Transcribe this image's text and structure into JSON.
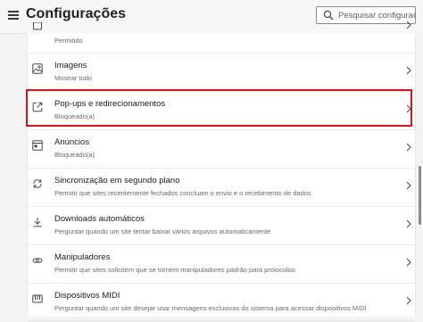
{
  "header": {
    "title": "Configurações",
    "search_placeholder": "Pesquisar configurações"
  },
  "rows": [
    {
      "label": "",
      "sub": "Permitido",
      "icon": "partial-icon"
    },
    {
      "label": "Imagens",
      "sub": "Mostrar tudo",
      "icon": "image-icon"
    },
    {
      "label": "Pop-ups e redirecionamentos",
      "sub": "Bloqueado(a)",
      "icon": "popup-icon",
      "highlighted": true
    },
    {
      "label": "Anúncios",
      "sub": "Bloqueado(a)",
      "icon": "ads-icon"
    },
    {
      "label": "Sincronização em segundo plano",
      "sub": "Permitir que sites recentemente fechados concluam o envio e o recebimento de dados",
      "icon": "sync-icon"
    },
    {
      "label": "Downloads automáticos",
      "sub": "Perguntar quando um site tentar baixar vários arquivos automaticamente",
      "icon": "download-icon"
    },
    {
      "label": "Manipuladores",
      "sub": "Permitir que sites solicitem que se tornem manipuladores padrão para protocolos",
      "icon": "link-icon"
    },
    {
      "label": "Dispositivos MIDI",
      "sub": "Perguntar quando um site desejar usar mensagens exclusivas do sistema para acessar dispositivos MIDI",
      "icon": "midi-icon"
    }
  ],
  "colors": {
    "highlight": "#d9141a",
    "background": "#f3f3f3",
    "panel": "#ffffff"
  }
}
